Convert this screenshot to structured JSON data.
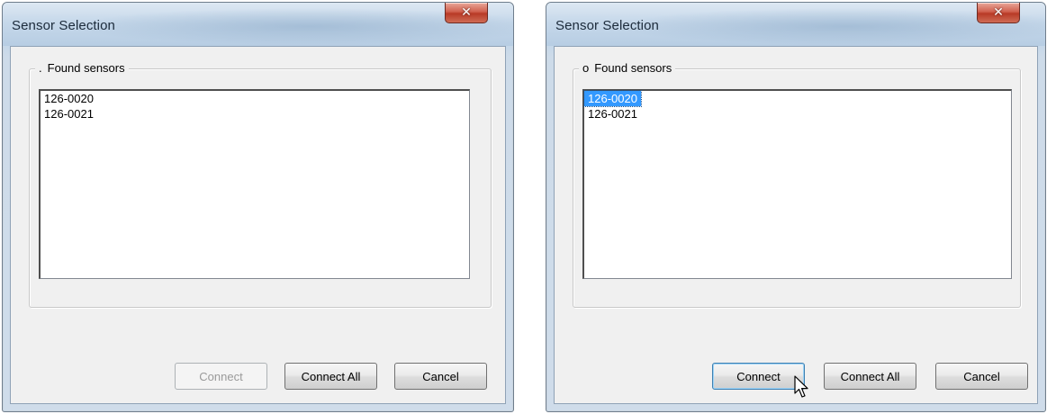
{
  "dialogs": [
    {
      "title": "Sensor Selection",
      "close_glyph": "✕",
      "group": {
        "bullet": ".",
        "label": "Found sensors"
      },
      "sensors": [
        "126-0020",
        "126-0021"
      ],
      "selected_index": null,
      "buttons": {
        "connect": "Connect",
        "connect_all": "Connect All",
        "cancel": "Cancel"
      },
      "connect_enabled": false
    },
    {
      "title": "Sensor Selection",
      "close_glyph": "✕",
      "group": {
        "bullet": "o",
        "label": "Found sensors"
      },
      "sensors": [
        "126-0020",
        "126-0021"
      ],
      "selected_index": 0,
      "buttons": {
        "connect": "Connect",
        "connect_all": "Connect All",
        "cancel": "Cancel"
      },
      "connect_enabled": true
    }
  ],
  "icons": {
    "close": "close-icon",
    "cursor": "mouse-pointer-icon"
  },
  "colors": {
    "selection": "#3399ff",
    "close_button": "#c8513d"
  }
}
